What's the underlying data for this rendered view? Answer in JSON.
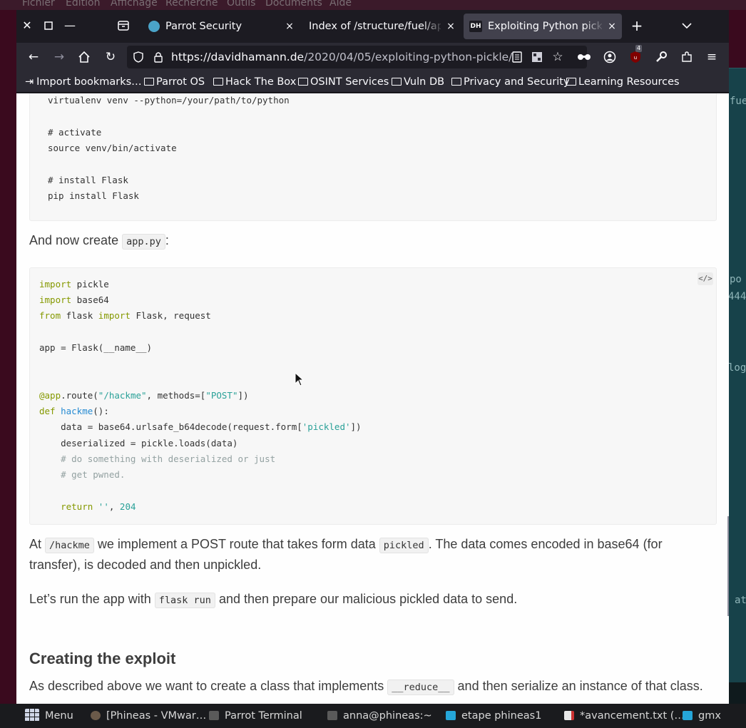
{
  "desktop": {
    "menu": [
      "Fichier",
      "Édition",
      "Affichage",
      "Recherche",
      "Outils",
      "Documents",
      "Aide"
    ],
    "bg_window_fragments": [
      "fue",
      "po",
      "444",
      "log",
      "at"
    ]
  },
  "browser": {
    "tabs": [
      {
        "title": "Parrot Security",
        "icon": "globe-icon",
        "close": "×"
      },
      {
        "title": "Index of /structure/fuel/application",
        "icon": "none",
        "close": "×"
      },
      {
        "title": "Exploiting Python pickles",
        "icon": "dh-favicon",
        "favicon_text": "DH",
        "close": "×"
      }
    ],
    "new_tab": "+",
    "tab_list": "⌄",
    "url": {
      "host": "https://davidhamann.de",
      "path": "/2020/04/05/exploiting-python-pickle/"
    },
    "extension_badge": "4",
    "bookmarks": [
      {
        "label": "Import bookmarks…",
        "icon": "import-icon"
      },
      {
        "label": "Parrot OS",
        "icon": "folder-icon"
      },
      {
        "label": "Hack The Box",
        "icon": "folder-icon"
      },
      {
        "label": "OSINT Services",
        "icon": "folder-icon"
      },
      {
        "label": "Vuln DB",
        "icon": "folder-icon"
      },
      {
        "label": "Privacy and Security",
        "icon": "folder-icon"
      },
      {
        "label": "Learning Resources",
        "icon": "folder-icon"
      }
    ]
  },
  "page": {
    "code1": [
      "virtualenv venv --python=/your/path/to/python",
      "",
      "# activate",
      "source venv/bin/activate",
      "",
      "# install Flask",
      "pip install Flask"
    ],
    "para1": {
      "before": "And now create ",
      "code": "app.py",
      "after": ":"
    },
    "code2_toggle": "</>",
    "code2": {
      "l1a": "import",
      "l1b": " pickle",
      "l2a": "import",
      "l2b": " base64",
      "l3a": "from",
      "l3b": " flask ",
      "l3c": "import",
      "l3d": " Flask, request",
      "l4": "app = Flask(__name__)",
      "l5a": "@app",
      "l5b": ".route(",
      "l5c": "\"/hackme\"",
      "l5d": ", methods=[",
      "l5e": "\"POST\"",
      "l5f": "])",
      "l6a": "def",
      "l6b": " ",
      "l6c": "hackme",
      "l6d": "():",
      "l7a": "    data = base64.urlsafe_b64decode(request.form[",
      "l7b": "'pickled'",
      "l7c": "])",
      "l8": "    deserialized = pickle.loads(data)",
      "l9": "    # do something with deserialized or just",
      "l10": "    # get pwned.",
      "l11a": "    return",
      "l11b": " ",
      "l11c": "''",
      "l11d": ", ",
      "l11e": "204"
    },
    "para2": {
      "a": "At ",
      "code1": "/hackme",
      "b": " we implement a POST route that takes form data ",
      "code2": "pickled",
      "c": ". The data comes encoded in base64 (for",
      "line2": "transfer), is decoded and then unpickled."
    },
    "para3": {
      "a": "Let’s run the app with ",
      "code": "flask run",
      "b": " and then prepare our malicious pickled data to send."
    },
    "heading": "Creating the exploit",
    "para4": {
      "a": "As described above we want to create a class that implements ",
      "code": "__reduce__",
      "b": " and then serialize an instance of that class."
    }
  },
  "taskbar": [
    {
      "label": "Menu",
      "icon": "apps-grid-icon"
    },
    {
      "label": "[Phineas - VMwar…",
      "icon": "vmware-icon"
    },
    {
      "label": "Parrot Terminal",
      "icon": "terminal-icon"
    },
    {
      "label": "anna@phineas:~",
      "icon": "terminal-icon"
    },
    {
      "label": "etape phineas1",
      "icon": "folder-icon"
    },
    {
      "label": "*avancement.txt (…",
      "icon": "text-editor-icon"
    },
    {
      "label": "gmx",
      "icon": "folder-icon"
    }
  ]
}
